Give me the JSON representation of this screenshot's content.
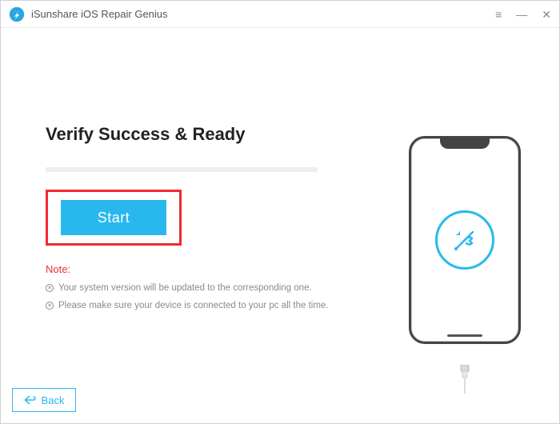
{
  "app": {
    "title": "iSunshare iOS Repair Genius"
  },
  "main": {
    "heading": "Verify Success & Ready",
    "start_label": "Start",
    "note_label": "Note:",
    "notes": [
      "Your system version will be updated to the corresponding one.",
      "Please make sure your device is connected to your pc all the time."
    ]
  },
  "footer": {
    "back_label": "Back"
  },
  "colors": {
    "accent": "#28b8ee",
    "danger": "#ef2b2f"
  }
}
